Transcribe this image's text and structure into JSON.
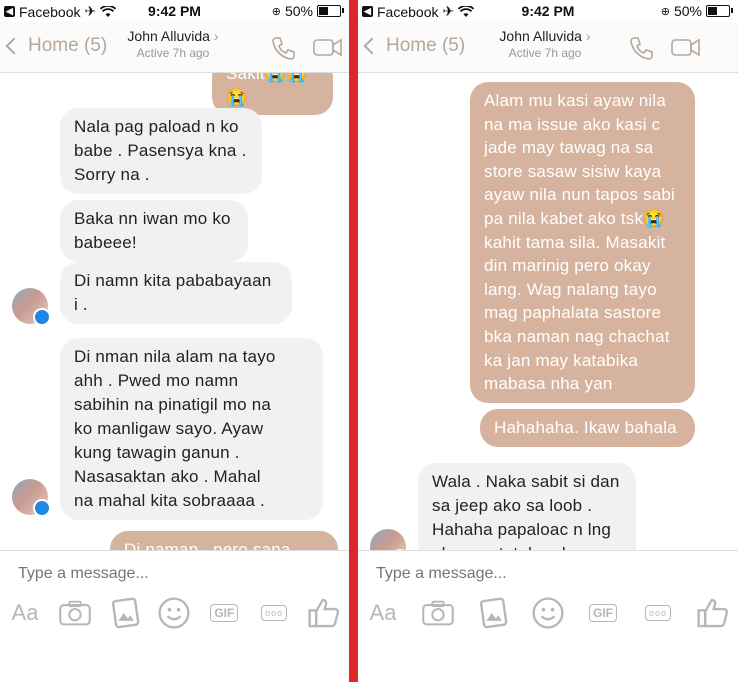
{
  "left": {
    "status": {
      "carrier": "Facebook",
      "time": "9:42 PM",
      "battery": "50%"
    },
    "nav": {
      "back_label": "Home (5)",
      "contact_name": "John Alluvida",
      "contact_status": "Active 7h ago"
    },
    "messages": [
      {
        "dir": "out",
        "text": "Sakit😭😭😭"
      },
      {
        "dir": "in",
        "text": "Nala pag paload n ko\nbabe . Pasensya kna .\nSorry na ."
      },
      {
        "dir": "in",
        "text": "Baka nn iwan mo ko\nbabeee!"
      },
      {
        "dir": "in",
        "text": "Di namn kita pababayaan\ni ."
      },
      {
        "dir": "in",
        "text": "Di nman nila alam na tayo\nahh . Pwed mo namn\nsabihin na pinatigil mo na\nko manligaw sayo. Ayaw\nkung tawagin ganun .\nNasasaktan ako . Mahal\nna mahal kita sobraaaa ."
      },
      {
        "dir": "out",
        "text": "Di naman . pero sana"
      }
    ],
    "composer": {
      "placeholder": "Type a message...",
      "aa": "Aa",
      "gif": "GIF",
      "more": "ooo"
    }
  },
  "right": {
    "status": {
      "carrier": "Facebook",
      "time": "9:42 PM",
      "battery": "50%"
    },
    "nav": {
      "back_label": "Home (5)",
      "contact_name": "John Alluvida",
      "contact_status": "Active 7h ago"
    },
    "messages": [
      {
        "dir": "out",
        "text": "Alam mu kasi ayaw nila\nna ma issue ako kasi c\njade may tawag na sa\nstore  sasaw sisiw  kaya\nayaw nila nun tapos sabi\npa nila kabet ako tsk😭\nkahit tama sila. Masakit\ndin marinig pero okay\nlang. Wag nalang tayo\nmag paphalata sastore\nbka naman  nag chachat\nka jan may katabika\nmabasa nha yan"
      },
      {
        "dir": "out",
        "text": "Hahahaha. Ikaw bahala"
      },
      {
        "dir": "in",
        "text": "Wala . Naka sabit si dan\nsa jeep ako sa loob .\nHahaha papaloac n lng\nako pag tataho ako ."
      }
    ],
    "composer": {
      "placeholder": "Type a message...",
      "aa": "Aa",
      "gif": "GIF",
      "more": "ooo"
    }
  },
  "colors": {
    "outgoing": "#d6b39e",
    "incoming": "#f1f1f1",
    "accent": "#b6a79a",
    "divider": "#e0262d"
  },
  "icons": [
    "back-app-icon",
    "airplane-icon",
    "wifi-icon",
    "rotation-lock-icon",
    "battery-icon",
    "chevron-left-icon",
    "phone-icon",
    "video-camera-icon",
    "camera-icon",
    "gallery-icon",
    "emoji-icon",
    "gif-icon",
    "more-icon",
    "like-icon",
    "messenger-badge-icon"
  ]
}
